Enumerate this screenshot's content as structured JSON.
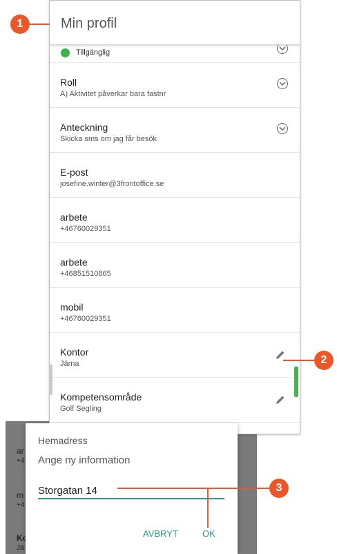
{
  "header": {
    "title": "Min profil"
  },
  "status": {
    "label": "Tillgänglig",
    "color": "#3bb54a"
  },
  "rows": [
    {
      "label": "Roll",
      "value": "A) Aktivitet påverkar bara fastnr",
      "action": "chevron"
    },
    {
      "label": "Anteckning",
      "value": "Skicka sms om jag får besök",
      "action": "chevron"
    },
    {
      "label": "E-post",
      "value": "josefine.winter@3frontoffice.se",
      "action": "none"
    },
    {
      "label": "arbete",
      "value": "+46760029351",
      "action": "none"
    },
    {
      "label": "arbete",
      "value": "+46851510865",
      "action": "none"
    },
    {
      "label": "mobil",
      "value": "+46760029351",
      "action": "none"
    },
    {
      "label": "Kontor",
      "value": "Järna",
      "action": "edit"
    },
    {
      "label": "Kompetensområde",
      "value": "Golf Segling",
      "action": "edit"
    }
  ],
  "background_rows": [
    {
      "label": "ar",
      "value": "+4"
    },
    {
      "label": "m",
      "value": "+4"
    },
    {
      "label": "Ko",
      "value": "Jä"
    }
  ],
  "dialog": {
    "title": "Hemadress",
    "message": "Ange ny information",
    "input_value": "Storgatan 14",
    "cancel_label": "AVBRYT",
    "ok_label": "OK"
  },
  "callouts": {
    "one": "1",
    "two": "2",
    "three": "3",
    "color": "#e9572a"
  },
  "colors": {
    "accent": "#2a9d91",
    "scroll_indicator": "#49b24e"
  }
}
